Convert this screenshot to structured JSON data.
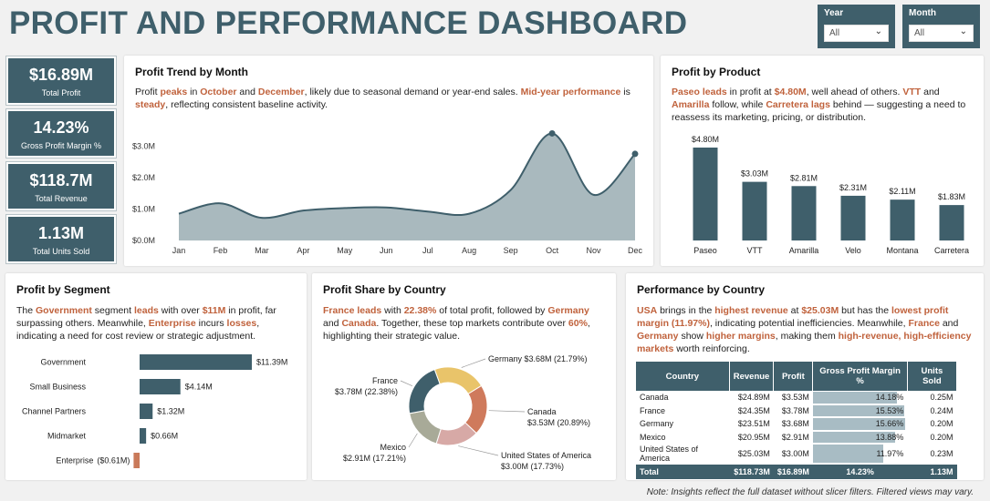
{
  "title": "PROFIT AND PERFORMANCE DASHBOARD",
  "slicers": {
    "year": {
      "label": "Year",
      "value": "All"
    },
    "month": {
      "label": "Month",
      "value": "All"
    }
  },
  "kpis": [
    {
      "value": "$16.89M",
      "label": "Total Profit"
    },
    {
      "value": "14.23%",
      "label": "Gross Profit Margin %"
    },
    {
      "value": "$118.7M",
      "label": "Total Revenue"
    },
    {
      "value": "1.13M",
      "label": "Total Units Sold"
    }
  ],
  "trend": {
    "title": "Profit Trend by Month",
    "desc": [
      {
        "t": "Profit "
      },
      {
        "t": "peaks",
        "h": true
      },
      {
        "t": " in "
      },
      {
        "t": "October",
        "h": true
      },
      {
        "t": " and "
      },
      {
        "t": "December",
        "h": true
      },
      {
        "t": ", likely due to seasonal demand or year-end sales. "
      },
      {
        "t": "Mid-year performance",
        "h": true
      },
      {
        "t": " is "
      },
      {
        "t": "steady",
        "h": true
      },
      {
        "t": ", reflecting consistent baseline activity."
      }
    ]
  },
  "product": {
    "title": "Profit by Product",
    "desc": [
      {
        "t": "Paseo leads",
        "h": true
      },
      {
        "t": " in profit at "
      },
      {
        "t": "$4.80M",
        "h": true
      },
      {
        "t": ", well ahead of others. "
      },
      {
        "t": "VTT",
        "h": true
      },
      {
        "t": " and "
      },
      {
        "t": "Amarilla",
        "h": true
      },
      {
        "t": " follow, while "
      },
      {
        "t": "Carretera lags",
        "h": true
      },
      {
        "t": " behind — suggesting a need to reassess its marketing, pricing, or distribution."
      }
    ]
  },
  "segment": {
    "title": "Profit by Segment",
    "desc": [
      {
        "t": "The "
      },
      {
        "t": "Government",
        "h": true
      },
      {
        "t": " segment "
      },
      {
        "t": "leads",
        "h": true
      },
      {
        "t": " with over "
      },
      {
        "t": "$11M",
        "h": true
      },
      {
        "t": " in profit, far surpassing others. Meanwhile, "
      },
      {
        "t": "Enterprise",
        "h": true
      },
      {
        "t": " incurs "
      },
      {
        "t": "losses",
        "h": true
      },
      {
        "t": ", indicating a need for cost review or strategic adjustment."
      }
    ]
  },
  "share": {
    "title": "Profit Share by Country",
    "desc": [
      {
        "t": "France leads",
        "h": true
      },
      {
        "t": " with "
      },
      {
        "t": "22.38%",
        "h": true
      },
      {
        "t": " of total profit, followed by "
      },
      {
        "t": "Germany",
        "h": true
      },
      {
        "t": " and "
      },
      {
        "t": "Canada",
        "h": true
      },
      {
        "t": ". Together, these top markets contribute over "
      },
      {
        "t": "60%",
        "h": true
      },
      {
        "t": ", highlighting their strategic value."
      }
    ]
  },
  "performance": {
    "title": "Performance by Country",
    "desc": [
      {
        "t": "USA",
        "h": true
      },
      {
        "t": " brings in the "
      },
      {
        "t": "highest revenue",
        "h": true
      },
      {
        "t": " at "
      },
      {
        "t": "$25.03M",
        "h": true
      },
      {
        "t": " but has the "
      },
      {
        "t": "lowest profit margin (11.97%)",
        "h": true
      },
      {
        "t": ", indicating potential inefficiencies. Meanwhile, "
      },
      {
        "t": "France",
        "h": true
      },
      {
        "t": " and "
      },
      {
        "t": "Germany",
        "h": true
      },
      {
        "t": " show "
      },
      {
        "t": "higher margins",
        "h": true
      },
      {
        "t": ", making them "
      },
      {
        "t": "high-revenue, high-efficiency markets",
        "h": true
      },
      {
        "t": " worth reinforcing."
      }
    ],
    "columns": [
      "Country",
      "Revenue",
      "Profit",
      "Gross Profit Margin %",
      "Units Sold"
    ],
    "rows": [
      {
        "country": "Canada",
        "revenue": "$24.89M",
        "profit": "$3.53M",
        "margin": "14.18%",
        "margin_value": 14.18,
        "units": "0.25M"
      },
      {
        "country": "France",
        "revenue": "$24.35M",
        "profit": "$3.78M",
        "margin": "15.53%",
        "margin_value": 15.53,
        "units": "0.24M"
      },
      {
        "country": "Germany",
        "revenue": "$23.51M",
        "profit": "$3.68M",
        "margin": "15.66%",
        "margin_value": 15.66,
        "units": "0.20M"
      },
      {
        "country": "Mexico",
        "revenue": "$20.95M",
        "profit": "$2.91M",
        "margin": "13.88%",
        "margin_value": 13.88,
        "units": "0.20M"
      },
      {
        "country": "United States of America",
        "revenue": "$25.03M",
        "profit": "$3.00M",
        "margin": "11.97%",
        "margin_value": 11.97,
        "units": "0.23M"
      }
    ],
    "total": {
      "country": "Total",
      "revenue": "$118.73M",
      "profit": "$16.89M",
      "margin": "14.23%",
      "units": "1.13M"
    }
  },
  "note": "Note: Insights reflect the full dataset without slicer filters. Filtered views may vary.",
  "colors": {
    "primary": "#3f5f6b",
    "highlight": "#c0623c",
    "area": "#a9b9be",
    "negative": "#c97a5a"
  },
  "chart_data": [
    {
      "type": "area",
      "title": "Profit Trend by Month",
      "categories": [
        "Jan",
        "Feb",
        "Mar",
        "Apr",
        "May",
        "Jun",
        "Jul",
        "Aug",
        "Sep",
        "Oct",
        "Nov",
        "Dec"
      ],
      "values": [
        0.85,
        1.18,
        0.72,
        0.95,
        1.03,
        1.05,
        0.92,
        0.85,
        1.6,
        3.4,
        1.45,
        2.75
      ],
      "y_ticks": [
        "$0.0M",
        "$1.0M",
        "$2.0M",
        "$3.0M"
      ],
      "ylim": [
        0,
        3.5
      ],
      "markers": [
        9,
        11
      ]
    },
    {
      "type": "bar",
      "title": "Profit by Product",
      "categories": [
        "Paseo",
        "VTT",
        "Amarilla",
        "Velo",
        "Montana",
        "Carretera"
      ],
      "values": [
        4.8,
        3.03,
        2.81,
        2.31,
        2.11,
        1.83
      ],
      "labels": [
        "$4.80M",
        "$3.03M",
        "$2.81M",
        "$2.31M",
        "$2.11M",
        "$1.83M"
      ]
    },
    {
      "type": "bar",
      "orientation": "horizontal",
      "title": "Profit by Segment",
      "categories": [
        "Government",
        "Small Business",
        "Channel Partners",
        "Midmarket",
        "Enterprise"
      ],
      "values": [
        11.39,
        4.14,
        1.32,
        0.66,
        -0.61
      ],
      "labels": [
        "$11.39M",
        "$4.14M",
        "$1.32M",
        "$0.66M",
        "($0.61M)"
      ]
    },
    {
      "type": "pie",
      "title": "Profit Share by Country",
      "categories": [
        "Germany",
        "Canada",
        "United States of America",
        "Mexico",
        "France"
      ],
      "values": [
        21.79,
        20.89,
        17.73,
        17.21,
        22.38
      ],
      "labels": [
        "Germany $3.68M (21.79%)",
        "Canada\n$3.53M (20.89%)",
        "United States of America\n$3.00M (17.73%)",
        "Mexico\n$2.91M (17.21%)",
        "France\n$3.78M (22.38%)"
      ],
      "colors": [
        "#e9c46a",
        "#cf7a5c",
        "#d7a9a6",
        "#a8aa98",
        "#3f5f6b"
      ]
    }
  ]
}
